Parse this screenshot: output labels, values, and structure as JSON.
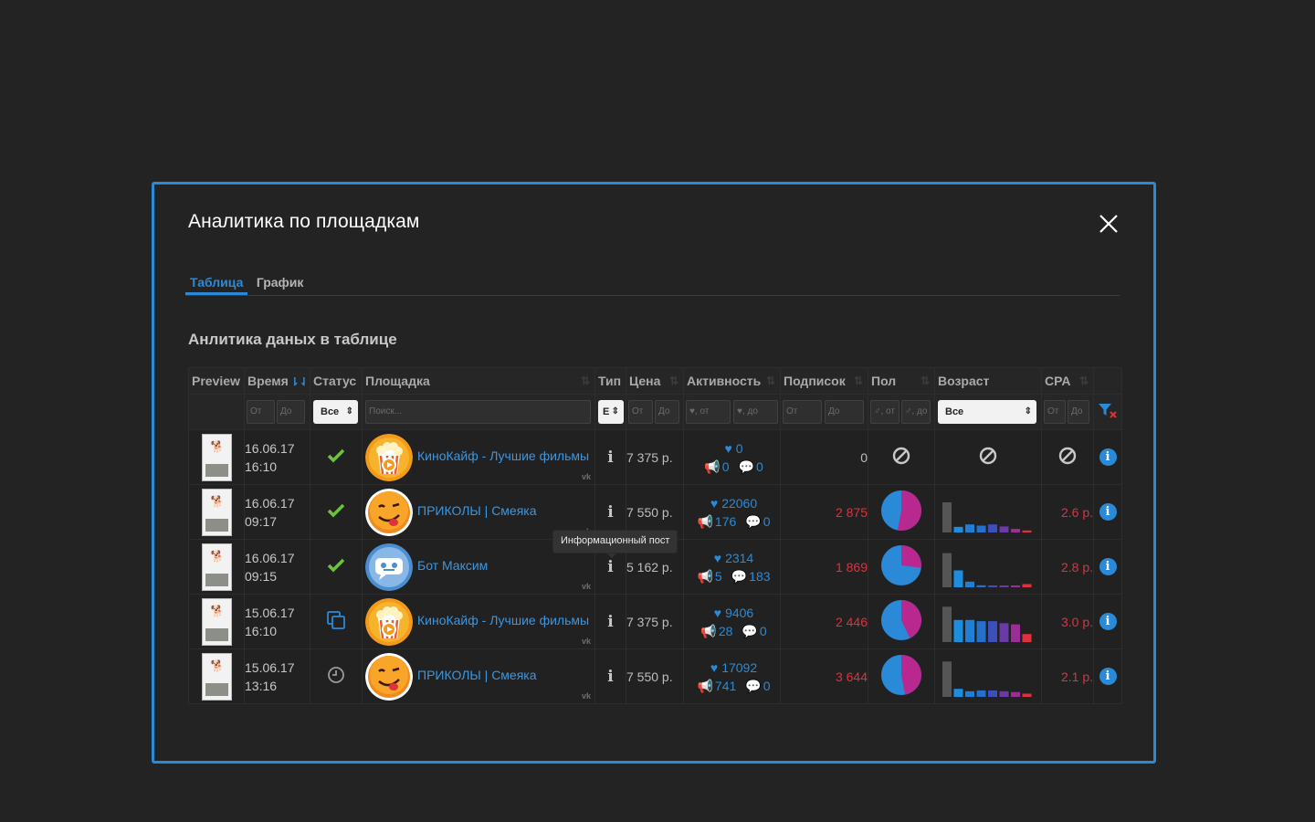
{
  "modal": {
    "title": "Аналитика по площадкам",
    "tabs": [
      {
        "label": "Таблица",
        "active": true
      },
      {
        "label": "График",
        "active": false
      }
    ],
    "section_title": "Анлитика даных в таблице"
  },
  "table": {
    "headers": [
      "Preview",
      "Время",
      "Статус",
      "Площадка",
      "Тип",
      "Цена",
      "Активность",
      "Подписок",
      "Пол",
      "Возраст",
      "CPA"
    ],
    "filters": {
      "time_from": "От",
      "time_to": "До",
      "status": "Все",
      "venue_search": "Поиск...",
      "type": "Е",
      "price_from": "От",
      "price_to": "До",
      "activity_from": "♥, от",
      "activity_to": "♥, до",
      "subs_from": "От",
      "subs_to": "До",
      "gender_from": "♂, от",
      "gender_to": "♂, до",
      "age": "Все",
      "cpa_from": "От",
      "cpa_to": "До"
    },
    "rows": [
      {
        "date": "16.06.17",
        "time": "16:10",
        "status": "approved",
        "venue": "КиноКайф - Лучшие фильмы",
        "avatar": "popcorn-avatar",
        "type": "i",
        "price": "7 375 р.",
        "likes": "0",
        "reposts": "0",
        "comments": "0",
        "subs": "0",
        "cpa": "",
        "gender_female": null,
        "age": null
      },
      {
        "date": "16.06.17",
        "time": "09:17",
        "status": "approved",
        "venue": "ПРИКОЛЫ | Смеяка",
        "avatar": "smiley-avatar",
        "type": "i",
        "price": "7 550 р.",
        "likes": "22060",
        "reposts": "176",
        "comments": "0",
        "subs": "2 875",
        "cpa": "2.6 р.",
        "gender_female": 0.53,
        "age": [
          0.75,
          0.14,
          0.2,
          0.17,
          0.2,
          0.15,
          0.09,
          0.05
        ]
      },
      {
        "date": "16.06.17",
        "time": "09:15",
        "status": "approved",
        "venue": "Бот Максим",
        "avatar": "bot-avatar",
        "type": "i",
        "price": "5 162 р.",
        "likes": "2314",
        "reposts": "5",
        "comments": "183",
        "subs": "1 869",
        "cpa": "2.8 р.",
        "gender_female": 0.27,
        "age": [
          0.85,
          0.42,
          0.14,
          0.05,
          0.02,
          0.02,
          0.01,
          0.08
        ]
      },
      {
        "date": "15.06.17",
        "time": "16:10",
        "status": "copied",
        "venue": "КиноКайф - Лучшие фильмы",
        "avatar": "popcorn-avatar",
        "type": "i",
        "price": "7 375 р.",
        "likes": "9406",
        "reposts": "28",
        "comments": "0",
        "subs": "2 446",
        "cpa": "3.0 р.",
        "gender_female": 0.43,
        "age": [
          0.88,
          0.55,
          0.55,
          0.52,
          0.52,
          0.47,
          0.44,
          0.2
        ]
      },
      {
        "date": "15.06.17",
        "time": "13:16",
        "status": "pending",
        "venue": "ПРИКОЛЫ | Смеяка",
        "avatar": "smiley-avatar",
        "type": "i",
        "price": "7 550 р.",
        "likes": "17092",
        "reposts": "741",
        "comments": "0",
        "subs": "3 644",
        "cpa": "2.1 р.",
        "gender_female": 0.47,
        "age": [
          0.88,
          0.2,
          0.14,
          0.16,
          0.16,
          0.14,
          0.12,
          0.08
        ]
      }
    ],
    "tooltip": "Информационный пост"
  },
  "colors": {
    "accent": "#2b8ad8",
    "approved": "#6dc13f",
    "female": "#b8288f",
    "male": "#2b8ad8",
    "subs": "#e0313f",
    "age_bars": [
      "#555555",
      "#1a8ee0",
      "#1f7fd4",
      "#2670c8",
      "#3d4fb8",
      "#6a3aa8",
      "#9a2e96",
      "#e0313f"
    ]
  }
}
